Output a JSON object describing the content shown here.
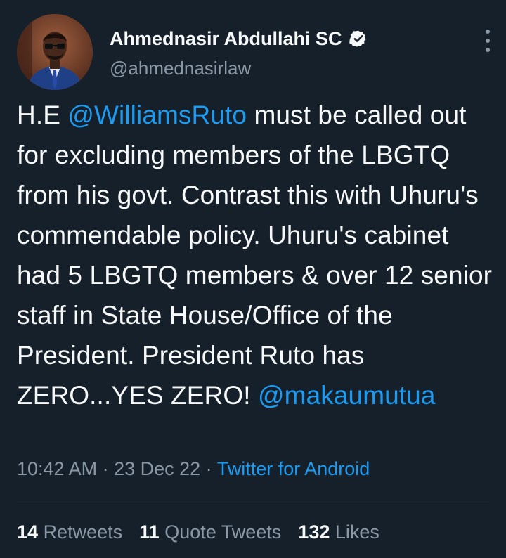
{
  "author": {
    "display_name": "Ahmednasir Abdullahi SC",
    "handle": "@ahmednasirlaw",
    "verified": true,
    "avatar_icon": "profile-photo"
  },
  "tweet": {
    "segments": [
      {
        "text": "H.E ",
        "type": "text"
      },
      {
        "text": "@WilliamsRuto",
        "type": "mention"
      },
      {
        "text": " must be called out for excluding members of the LBGTQ from his govt. Contrast this with Uhuru's commendable policy. Uhuru's cabinet had 5 LBGTQ members & over 12 senior staff in State House/Office of the President. President Ruto has ZERO...YES ZERO! ",
        "type": "text"
      },
      {
        "text": "@makaumutua",
        "type": "mention"
      }
    ]
  },
  "meta": {
    "time": "10:42 AM",
    "separator": " · ",
    "date": "23 Dec 22",
    "source": "Twitter for Android"
  },
  "stats": {
    "retweets_count": "14",
    "retweets_label": "Retweets",
    "quotes_count": "11",
    "quotes_label": "Quote Tweets",
    "likes_count": "132",
    "likes_label": "Likes"
  },
  "colors": {
    "background": "#15202b",
    "text": "#f7f9f9",
    "secondary": "#8b98a5",
    "accent": "#1d9bf0"
  }
}
